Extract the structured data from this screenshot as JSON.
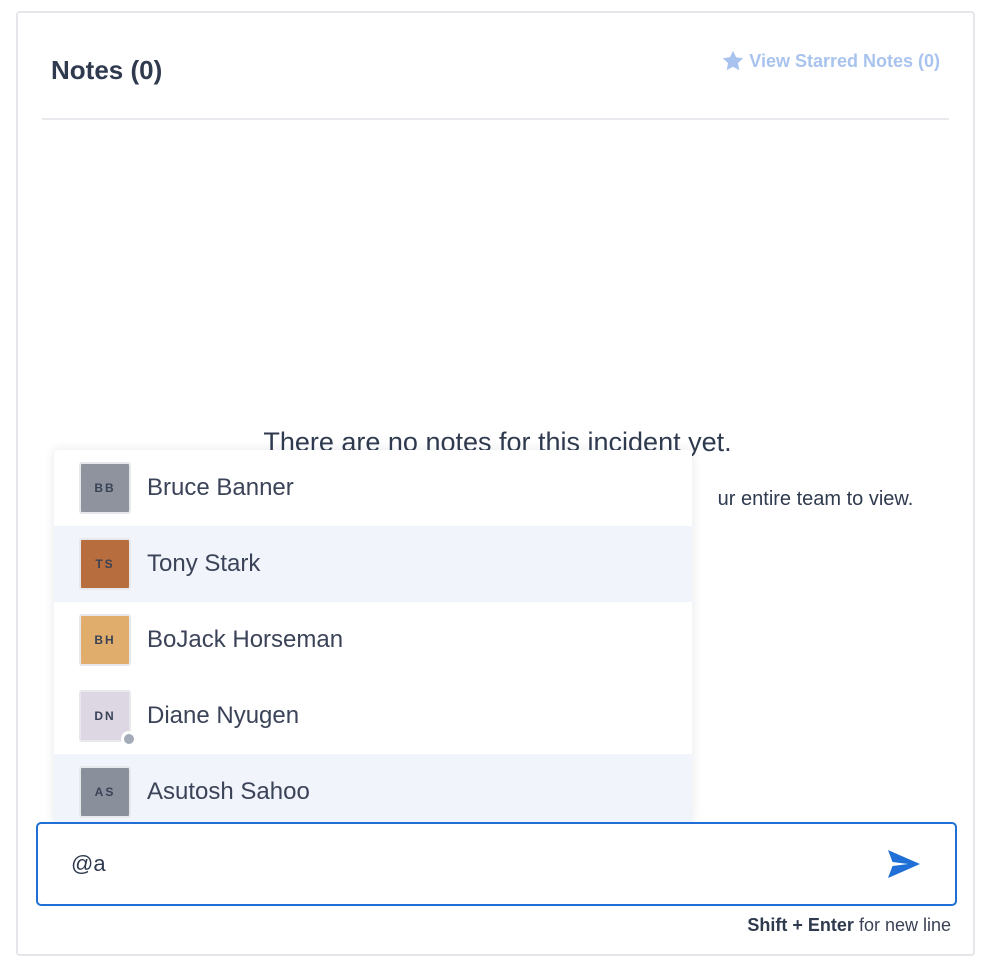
{
  "header": {
    "title": "Notes (0)",
    "starred_link": "View Starred Notes (0)",
    "star_icon": "star-icon",
    "accent_color": "#a9c3ef"
  },
  "empty_state": {
    "title": "There are no notes for this incident yet.",
    "subtitle_visible_fragment": "ur entire team to view."
  },
  "mentions": [
    {
      "initials": "BB",
      "name": "Bruce Banner",
      "avatar_color": "#8e939e",
      "highlighted": false,
      "presence": false
    },
    {
      "initials": "TS",
      "name": "Tony Stark",
      "avatar_color": "#b86d3e",
      "highlighted": true,
      "presence": false
    },
    {
      "initials": "BH",
      "name": "BoJack Horseman",
      "avatar_color": "#e0ad6c",
      "highlighted": false,
      "presence": false
    },
    {
      "initials": "DN",
      "name": "Diane Nyugen",
      "avatar_color": "#dcd7e3",
      "highlighted": false,
      "presence": true
    },
    {
      "initials": "AS",
      "name": "Asutosh Sahoo",
      "avatar_color": "#8a909b",
      "highlighted": true,
      "presence": false
    }
  ],
  "composer": {
    "value": "@a",
    "send_icon": "send-icon",
    "border_color": "#1f6fd6"
  },
  "hint": {
    "keys": "Shift + Enter",
    "text": " for new line"
  }
}
